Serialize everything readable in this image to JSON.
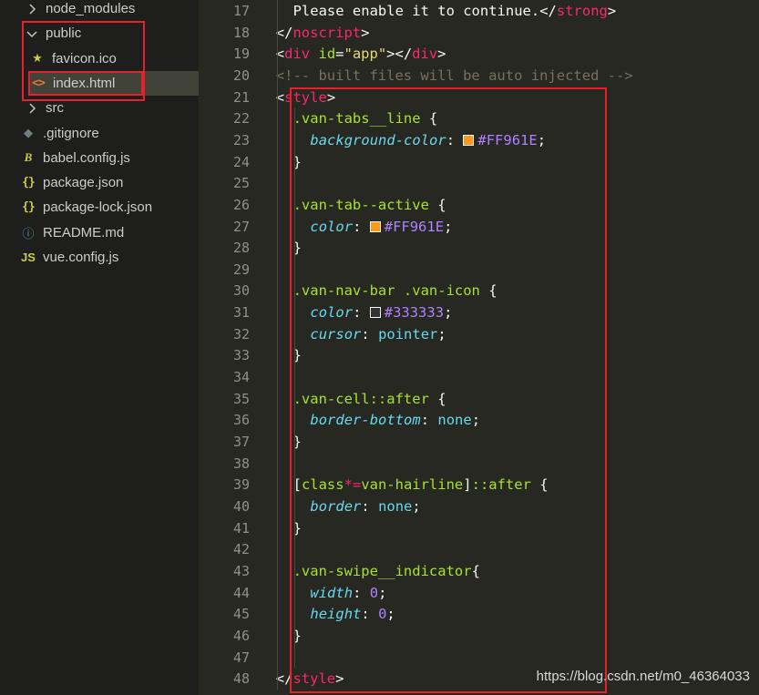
{
  "explorer": {
    "items": [
      {
        "name": "tree-folder-node-modules",
        "label": "node_modules",
        "icon": "chevron-right-icon",
        "glyph": "chev-right",
        "indent": 0,
        "selected": false
      },
      {
        "name": "tree-folder-public",
        "label": "public",
        "icon": "chevron-down-icon",
        "glyph": "chev-down",
        "indent": 0,
        "selected": false
      },
      {
        "name": "tree-file-favicon",
        "label": "favicon.ico",
        "icon": "star-icon",
        "glyph": "★",
        "iconClass": "ico-star",
        "indent": 1,
        "selected": false
      },
      {
        "name": "tree-file-index-html",
        "label": "index.html",
        "icon": "html-file-icon",
        "glyph": "<>",
        "iconClass": "ico-html",
        "indent": 1,
        "selected": true
      },
      {
        "name": "tree-folder-src",
        "label": "src",
        "icon": "chevron-right-icon",
        "glyph": "chev-right",
        "indent": 0,
        "selected": false
      },
      {
        "name": "tree-file-gitignore",
        "label": ".gitignore",
        "icon": "git-file-icon",
        "glyph": "◆",
        "iconClass": "ico-git",
        "indent": 0,
        "selected": false
      },
      {
        "name": "tree-file-babel-config",
        "label": "babel.config.js",
        "icon": "babel-file-icon",
        "glyph": "B",
        "iconClass": "ico-babel",
        "indent": 0,
        "selected": false
      },
      {
        "name": "tree-file-package-json",
        "label": "package.json",
        "icon": "json-file-icon",
        "glyph": "{}",
        "iconClass": "ico-json",
        "indent": 0,
        "selected": false
      },
      {
        "name": "tree-file-package-lock",
        "label": "package-lock.json",
        "icon": "json-file-icon",
        "glyph": "{}",
        "iconClass": "ico-json",
        "indent": 0,
        "selected": false
      },
      {
        "name": "tree-file-readme",
        "label": "README.md",
        "icon": "info-file-icon",
        "glyph": "ⓘ",
        "iconClass": "ico-info",
        "indent": 0,
        "selected": false
      },
      {
        "name": "tree-file-vue-config",
        "label": "vue.config.js",
        "icon": "js-file-icon",
        "glyph": "JS",
        "iconClass": "ico-js",
        "indent": 0,
        "selected": false
      }
    ]
  },
  "editor": {
    "lines": [
      {
        "n": "17",
        "indent": 2,
        "tokens": [
          [
            "text",
            "Please enable it to continue."
          ],
          [
            "punct",
            "</"
          ],
          [
            "tag",
            "strong"
          ],
          [
            "punct",
            ">"
          ]
        ]
      },
      {
        "n": "18",
        "indent": 1,
        "tokens": [
          [
            "punct",
            "</"
          ],
          [
            "tag",
            "noscript"
          ],
          [
            "punct",
            ">"
          ]
        ]
      },
      {
        "n": "19",
        "indent": 1,
        "tokens": [
          [
            "punct",
            "<"
          ],
          [
            "tag",
            "div"
          ],
          [
            "punct",
            " "
          ],
          [
            "attr",
            "id"
          ],
          [
            "punct",
            "="
          ],
          [
            "str",
            "\"app\""
          ],
          [
            "punct",
            "></"
          ],
          [
            "tag",
            "div"
          ],
          [
            "punct",
            ">"
          ]
        ]
      },
      {
        "n": "20",
        "indent": 1,
        "tokens": [
          [
            "comment",
            "<!-- built files will be auto injected -->"
          ]
        ]
      },
      {
        "n": "21",
        "indent": 1,
        "tokens": [
          [
            "punct",
            "<"
          ],
          [
            "tag",
            "style"
          ],
          [
            "punct",
            ">"
          ]
        ]
      },
      {
        "n": "22",
        "indent": 2,
        "tokens": [
          [
            "sel",
            ".van-tabs__line"
          ],
          [
            "punct",
            " {"
          ]
        ]
      },
      {
        "n": "23",
        "indent": 3,
        "tokens": [
          [
            "prop",
            "background-color"
          ],
          [
            "punct",
            ": "
          ],
          [
            "swatch",
            "#FF961E"
          ],
          [
            "color",
            "#FF961E"
          ],
          [
            "punct",
            ";"
          ]
        ]
      },
      {
        "n": "24",
        "indent": 2,
        "tokens": [
          [
            "punct",
            "}"
          ]
        ]
      },
      {
        "n": "25",
        "indent": 2,
        "tokens": []
      },
      {
        "n": "26",
        "indent": 2,
        "tokens": [
          [
            "sel",
            ".van-tab--active"
          ],
          [
            "punct",
            " {"
          ]
        ]
      },
      {
        "n": "27",
        "indent": 3,
        "tokens": [
          [
            "prop",
            "color"
          ],
          [
            "punct",
            ": "
          ],
          [
            "swatch",
            "#FF961E"
          ],
          [
            "color",
            "#FF961E"
          ],
          [
            "punct",
            ";"
          ]
        ]
      },
      {
        "n": "28",
        "indent": 2,
        "tokens": [
          [
            "punct",
            "}"
          ]
        ]
      },
      {
        "n": "29",
        "indent": 2,
        "tokens": []
      },
      {
        "n": "30",
        "indent": 2,
        "tokens": [
          [
            "sel",
            ".van-nav-bar .van-icon"
          ],
          [
            "punct",
            " {"
          ]
        ]
      },
      {
        "n": "31",
        "indent": 3,
        "tokens": [
          [
            "prop",
            "color"
          ],
          [
            "punct",
            ": "
          ],
          [
            "swatch",
            "#333333"
          ],
          [
            "color",
            "#333333"
          ],
          [
            "punct",
            ";"
          ]
        ]
      },
      {
        "n": "32",
        "indent": 3,
        "tokens": [
          [
            "prop",
            "cursor"
          ],
          [
            "punct",
            ": "
          ],
          [
            "val",
            "pointer"
          ],
          [
            "punct",
            ";"
          ]
        ]
      },
      {
        "n": "33",
        "indent": 2,
        "tokens": [
          [
            "punct",
            "}"
          ]
        ]
      },
      {
        "n": "34",
        "indent": 2,
        "tokens": []
      },
      {
        "n": "35",
        "indent": 2,
        "tokens": [
          [
            "sel",
            ".van-cell::after"
          ],
          [
            "punct",
            " {"
          ]
        ]
      },
      {
        "n": "36",
        "indent": 3,
        "tokens": [
          [
            "prop",
            "border-bottom"
          ],
          [
            "punct",
            ": "
          ],
          [
            "val",
            "none"
          ],
          [
            "punct",
            ";"
          ]
        ]
      },
      {
        "n": "37",
        "indent": 2,
        "tokens": [
          [
            "punct",
            "}"
          ]
        ]
      },
      {
        "n": "38",
        "indent": 2,
        "tokens": []
      },
      {
        "n": "39",
        "indent": 2,
        "tokens": [
          [
            "punct",
            "["
          ],
          [
            "sel",
            "class"
          ],
          [
            "op",
            "*="
          ],
          [
            "sel",
            "van-hairline"
          ],
          [
            "punct",
            "]"
          ],
          [
            "sel",
            "::after"
          ],
          [
            "punct",
            " {"
          ]
        ]
      },
      {
        "n": "40",
        "indent": 3,
        "tokens": [
          [
            "prop",
            "border"
          ],
          [
            "punct",
            ": "
          ],
          [
            "val",
            "none"
          ],
          [
            "punct",
            ";"
          ]
        ]
      },
      {
        "n": "41",
        "indent": 2,
        "tokens": [
          [
            "punct",
            "}"
          ]
        ]
      },
      {
        "n": "42",
        "indent": 2,
        "tokens": []
      },
      {
        "n": "43",
        "indent": 2,
        "tokens": [
          [
            "sel",
            ".van-swipe__indicator"
          ],
          [
            "punct",
            "{"
          ]
        ]
      },
      {
        "n": "44",
        "indent": 3,
        "tokens": [
          [
            "prop",
            "width"
          ],
          [
            "punct",
            ": "
          ],
          [
            "num",
            "0"
          ],
          [
            "punct",
            ";"
          ]
        ]
      },
      {
        "n": "45",
        "indent": 3,
        "tokens": [
          [
            "prop",
            "height"
          ],
          [
            "punct",
            ": "
          ],
          [
            "num",
            "0"
          ],
          [
            "punct",
            ";"
          ]
        ]
      },
      {
        "n": "46",
        "indent": 2,
        "tokens": [
          [
            "punct",
            "}"
          ]
        ]
      },
      {
        "n": "47",
        "indent": 2,
        "tokens": []
      },
      {
        "n": "48",
        "indent": 1,
        "tokens": [
          [
            "punct",
            "</"
          ],
          [
            "tag",
            "style"
          ],
          [
            "punct",
            ">"
          ]
        ]
      }
    ]
  },
  "watermark": "https://blog.csdn.net/m0_46364033",
  "colors": {
    "highlight": "#e8202a",
    "background": "#272822",
    "sidebar": "#1e1f1c"
  }
}
